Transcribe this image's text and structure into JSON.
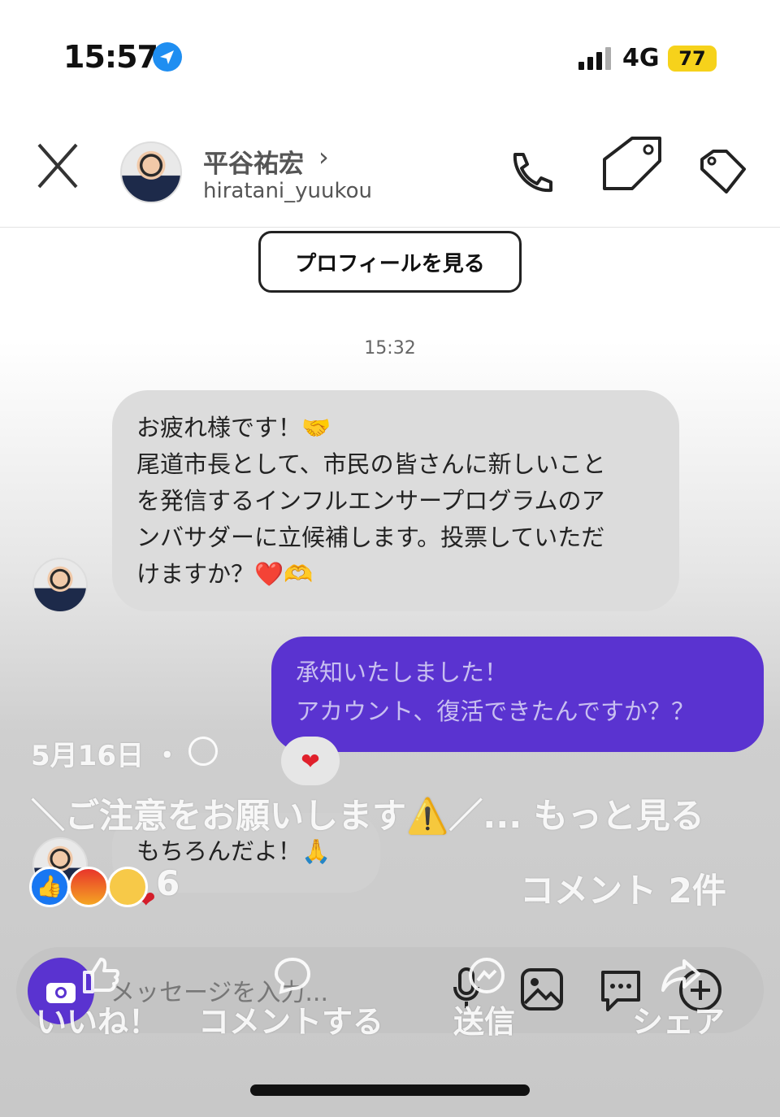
{
  "status_bar": {
    "time": "15:57",
    "network": "4G",
    "battery": "77"
  },
  "header": {
    "name": "平谷祐宏",
    "chevron": "›",
    "handle": "hiratani_yuukou"
  },
  "profile_button": "プロフィールを見る",
  "timestamp": "15:32",
  "messages": {
    "incoming1": {
      "line1": "お疲れ様です！🤝",
      "line2": "尾道市長として、市民の皆さんに新しいこと",
      "line3": "を発信するインフルエンサープログラムのア",
      "line4": "ンバサダーに立候補します。投票していただ",
      "line5": "けますか？❤️🫶"
    },
    "outgoing1": {
      "line1": "承知いたしました！",
      "line2": "アカウント、復活できたんですか？？",
      "reaction": "❤"
    },
    "incoming2": {
      "text": "もちろんだよ！🙏",
      "reaction": "❤"
    }
  },
  "composer": {
    "placeholder": "メッセージを入力..."
  },
  "facebook_overlay": {
    "date": "5月16日 ・",
    "caption": "＼ご注意をお願いします⚠️／... もっと見る",
    "reaction_count": "6",
    "comments": "コメント 2件",
    "like": "いいね！",
    "comment": "コメントする",
    "send": "送信",
    "share": "シェア"
  },
  "colors": {
    "accent": "#5a33d0",
    "fb_blue": "#1877f2",
    "battery": "#f6d21b"
  }
}
